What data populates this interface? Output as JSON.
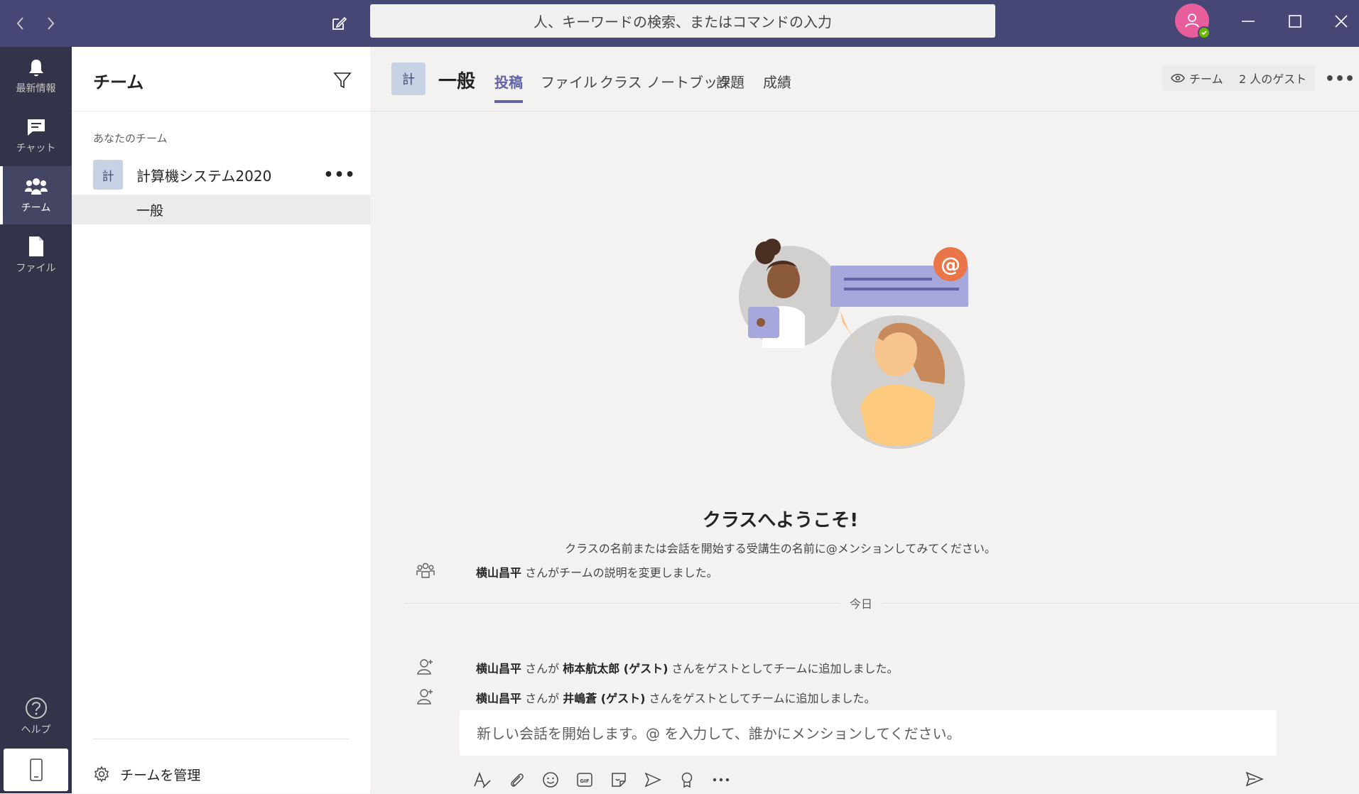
{
  "topbar": {
    "search_placeholder": "人、キーワードの検索、またはコマンドの入力"
  },
  "rail": {
    "items": [
      {
        "label": "最新情報",
        "icon": "bell-icon"
      },
      {
        "label": "チャット",
        "icon": "chat-icon"
      },
      {
        "label": "チーム",
        "icon": "teams-icon"
      },
      {
        "label": "ファイル",
        "icon": "file-icon"
      }
    ],
    "help_label": "ヘルプ"
  },
  "pane": {
    "title": "チーム",
    "section_label": "あなたのチーム",
    "team": {
      "avatar": "計",
      "name": "計算機システム2020",
      "more": "•••"
    },
    "channel": {
      "name": "一般"
    },
    "manage_label": "チームを管理"
  },
  "main": {
    "avatar": "計",
    "channel_title": "一般",
    "tabs": [
      {
        "label": "投稿"
      },
      {
        "label": "ファイル"
      },
      {
        "label": "クラス ノートブック"
      },
      {
        "label": "課題"
      },
      {
        "label": "成績"
      }
    ],
    "team_pill": "チーム",
    "guest_pill": "2 人のゲスト",
    "more": "•••",
    "welcome_title": "クラスへようこそ!",
    "welcome_sub": "クラスの名前または会話を開始する受講生の名前に@メンションしてみてください。",
    "activity": [
      {
        "actor": "横山昌平",
        "text1": " さんがチームの説明を変更しました。"
      },
      {
        "actor": "横山昌平",
        "text1": " さんが ",
        "guest": "柿本航太郎 (ゲスト)",
        "text2": " さんをゲストとしてチームに追加しました。"
      },
      {
        "actor": "横山昌平",
        "text1": " さんが ",
        "guest": "井嶋蒼 (ゲスト)",
        "text2": " さんをゲストとしてチームに追加しました。"
      }
    ],
    "today_label": "今日",
    "compose_placeholder": "新しい会話を開始します。@ を入力して、誰かにメンションしてください。"
  },
  "colors": {
    "titlebar": "#464775",
    "rail": "#33344a",
    "accent": "#6264a7",
    "avatar": "#e85d9b",
    "presence": "#6bb700"
  }
}
